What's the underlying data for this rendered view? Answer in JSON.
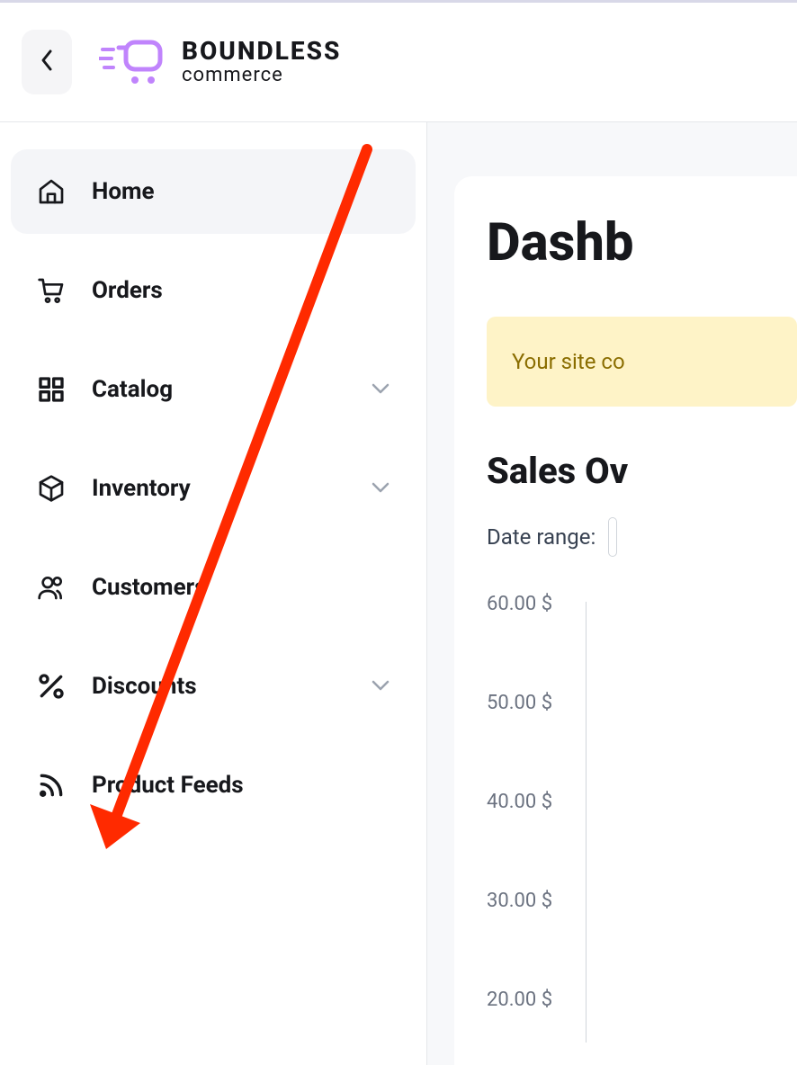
{
  "brand": {
    "name": "BOUNDLESS",
    "sub": "commerce"
  },
  "sidebar": {
    "items": [
      {
        "label": "Home",
        "icon": "home",
        "active": true,
        "expandable": false
      },
      {
        "label": "Orders",
        "icon": "cart",
        "active": false,
        "expandable": false
      },
      {
        "label": "Catalog",
        "icon": "grid",
        "active": false,
        "expandable": true
      },
      {
        "label": "Inventory",
        "icon": "box",
        "active": false,
        "expandable": true
      },
      {
        "label": "Customers",
        "icon": "users",
        "active": false,
        "expandable": false
      },
      {
        "label": "Discounts",
        "icon": "percent",
        "active": false,
        "expandable": true
      },
      {
        "label": "Product Feeds",
        "icon": "rss",
        "active": false,
        "expandable": false
      }
    ]
  },
  "page": {
    "title": "Dashb",
    "alert_text": "Your site co",
    "section_title": "Sales Ov",
    "date_range_label": "Date range:"
  },
  "chart_data": {
    "type": "line",
    "title": "Sales Overview",
    "xlabel": "",
    "ylabel": "",
    "ylim": [
      20,
      60
    ],
    "y_ticks": [
      "60.00 $",
      "50.00 $",
      "40.00 $",
      "30.00 $",
      "20.00 $"
    ],
    "categories": [],
    "values": []
  }
}
